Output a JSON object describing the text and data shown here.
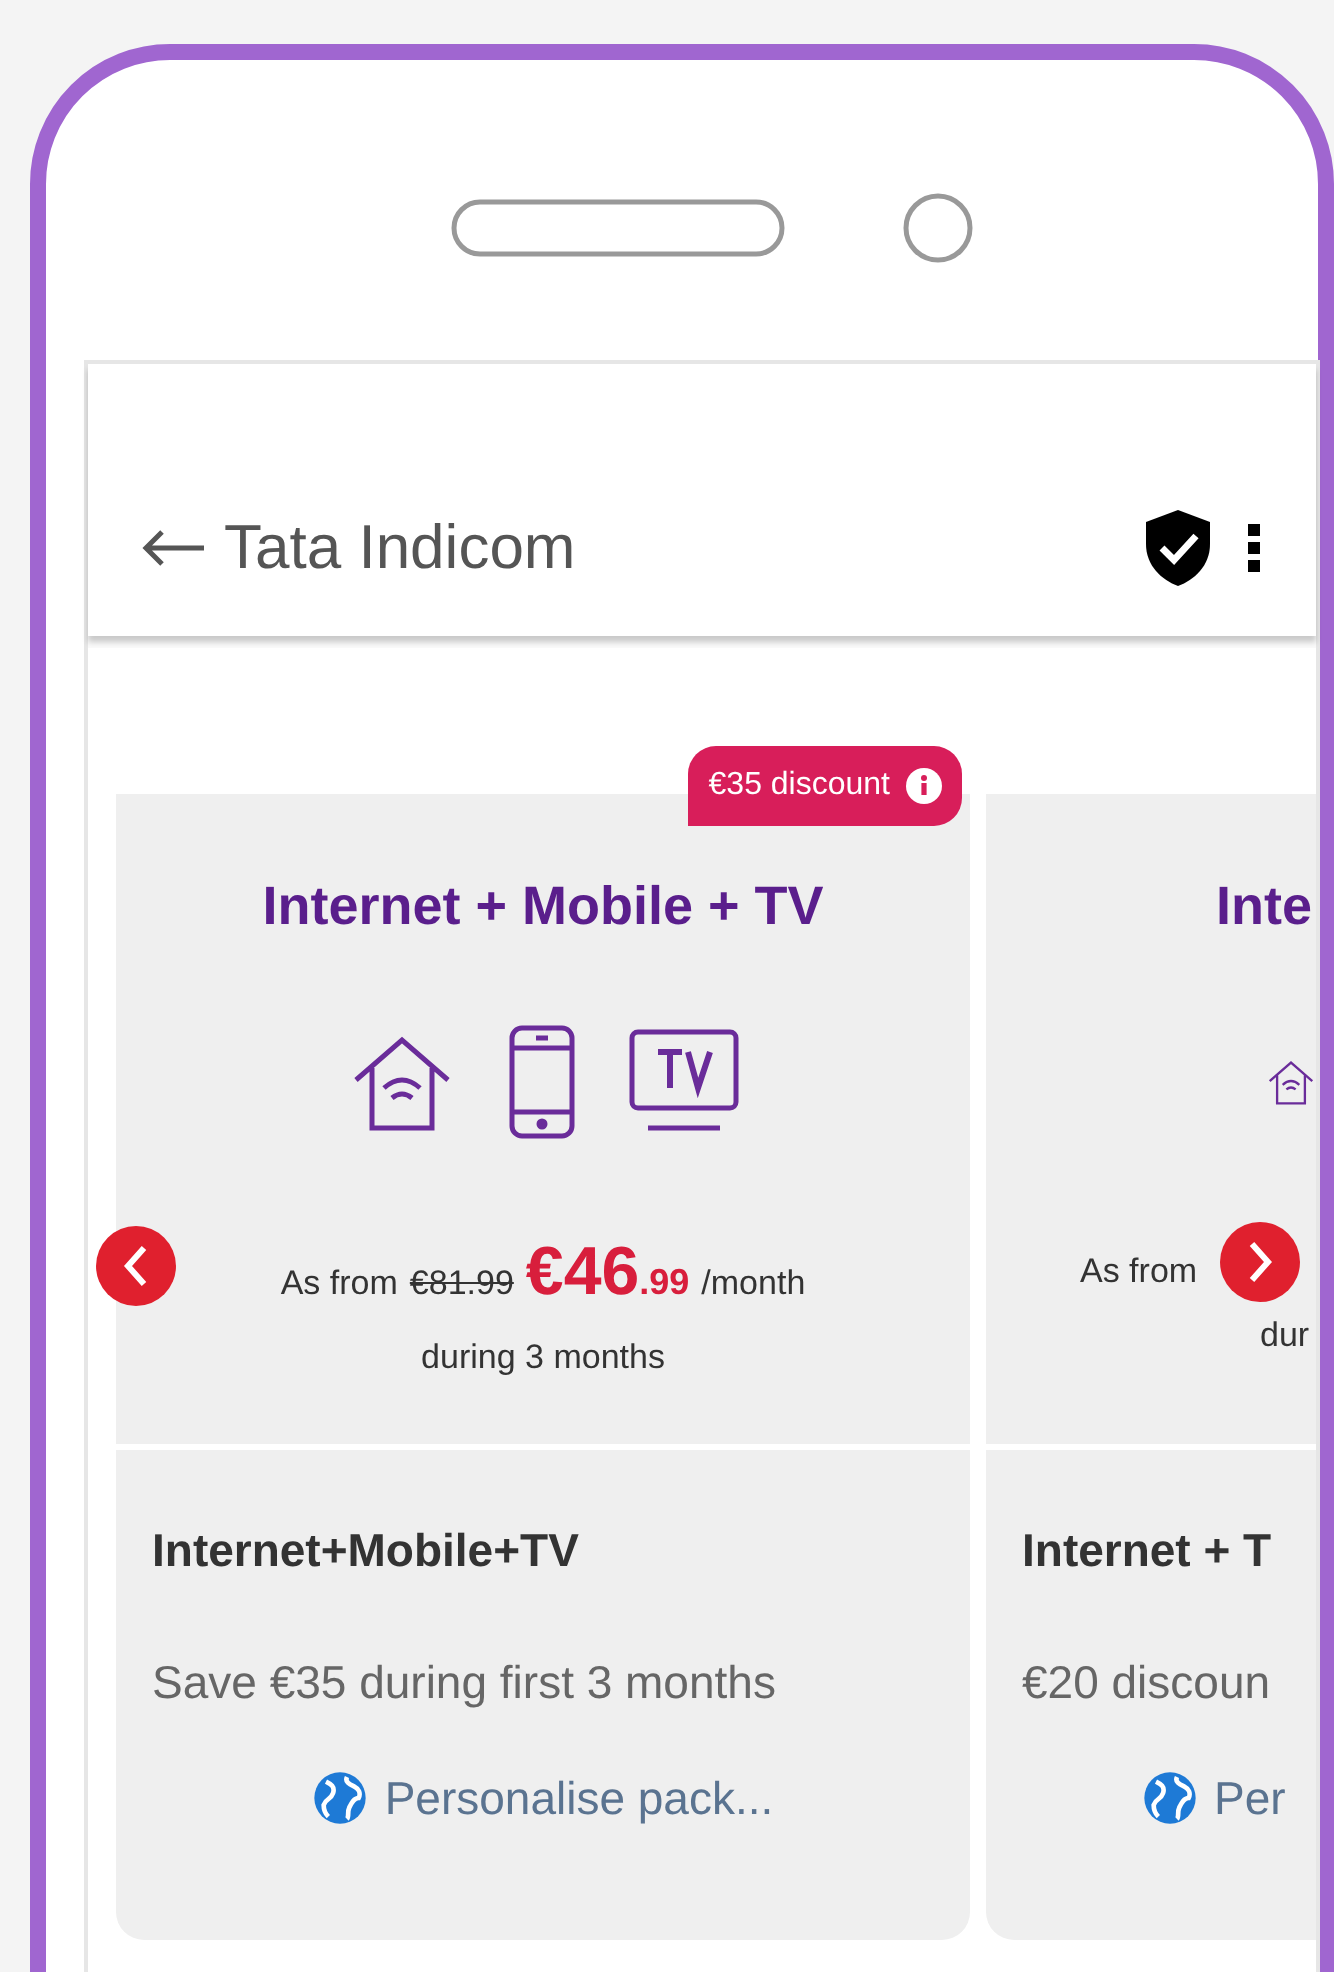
{
  "app_bar": {
    "title": "Tata Indicom"
  },
  "offers": [
    {
      "kind": "full",
      "badge": "€35 discount",
      "heading": "Internet + Mobile + TV",
      "price_prefix": "As from",
      "old_price": "€81.99",
      "price_whole": "€46",
      "price_cents": ".99",
      "period": "/month",
      "duration": "during 3 months",
      "name": "Internet+Mobile+TV",
      "description": "Save €35 during first 3 months",
      "link": "Personalise pack..."
    },
    {
      "kind": "clipped",
      "heading": "Inte",
      "price_prefix": "As from",
      "duration": "dur",
      "name": "Internet + T",
      "description": "€20 discoun",
      "link": "Per"
    }
  ]
}
